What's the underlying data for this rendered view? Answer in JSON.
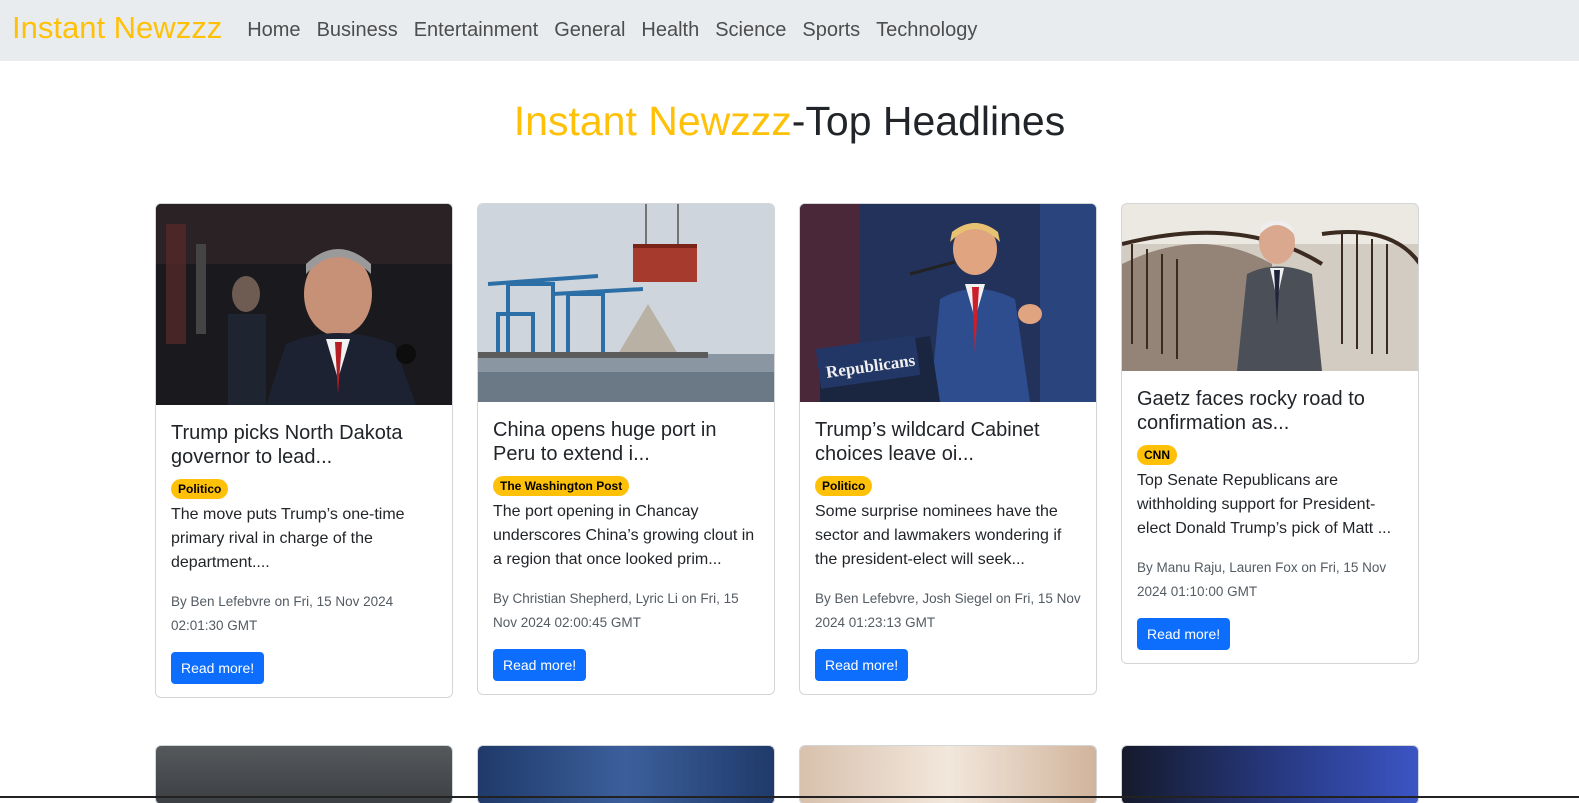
{
  "navbar": {
    "brand": "Instant Newzzz",
    "links": [
      "Home",
      "Business",
      "Entertainment",
      "General",
      "Health",
      "Science",
      "Sports",
      "Technology"
    ]
  },
  "heading": {
    "brand": "Instant Newzzz",
    "rest": "-Top Headlines"
  },
  "cards": [
    {
      "title": "Trump picks North Dakota governor to lead...",
      "source": "Politico",
      "description": "The move puts Trump’s one-time primary rival in charge of the department....",
      "meta": "By Ben Lefebvre on Fri, 15 Nov 2024 02:01:30 GMT",
      "button": "Read more!"
    },
    {
      "title": "China opens huge port in Peru to extend i...",
      "source": "The Washington Post",
      "description": "The port opening in Chancay underscores China’s growing clout in a region that once looked prim...",
      "meta": "By Christian Shepherd, Lyric Li on Fri, 15 Nov 2024 02:00:45 GMT",
      "button": "Read more!"
    },
    {
      "title": "Trump’s wildcard Cabinet choices leave oi...",
      "source": "Politico",
      "description": "Some surprise nominees have the sector and lawmakers wondering if the president-elect will seek...",
      "meta": "By Ben Lefebvre, Josh Siegel on Fri, 15 Nov 2024 01:23:13 GMT",
      "button": "Read more!"
    },
    {
      "title": "Gaetz faces rocky road to confirmation as...",
      "source": "CNN",
      "description": "Top Senate Republicans are withholding support for President-elect Donald Trump’s pick of Matt ...",
      "meta": "By Manu Raju, Lauren Fox on Fri, 15 Nov 2024 01:10:00 GMT",
      "button": "Read more!"
    }
  ],
  "image_text": {
    "podium_sign": "Republicans"
  },
  "colors": {
    "brand": "#ffc107",
    "primary": "#0d6efd",
    "navbar_bg": "#e9ecef"
  }
}
